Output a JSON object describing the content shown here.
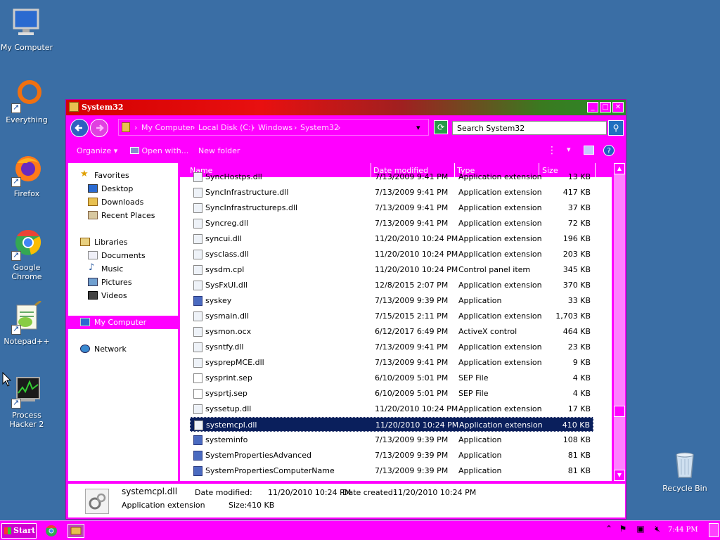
{
  "desktop": {
    "icons": [
      {
        "label": "My Computer"
      },
      {
        "label": "Everything"
      },
      {
        "label": "Firefox"
      },
      {
        "label": "Google Chrome"
      },
      {
        "label": "Notepad++"
      },
      {
        "label": "Process Hacker 2"
      },
      {
        "label": "Recycle Bin"
      }
    ]
  },
  "window": {
    "title": "System32",
    "breadcrumb": [
      "My Computer",
      "Local Disk (C:)",
      "Windows",
      "System32"
    ],
    "search_placeholder": "Search System32",
    "toolbar": {
      "organize": "Organize",
      "open_with": "Open with...",
      "new_folder": "New folder"
    },
    "nav": {
      "favorites": "Favorites",
      "desktop": "Desktop",
      "downloads": "Downloads",
      "recent": "Recent Places",
      "libraries": "Libraries",
      "documents": "Documents",
      "music": "Music",
      "pictures": "Pictures",
      "videos": "Videos",
      "my_computer": "My Computer",
      "network": "Network"
    },
    "columns": {
      "name": "Name",
      "date": "Date modified",
      "type": "Type",
      "size": "Size"
    },
    "files": [
      {
        "name": "SyncHostps.dll",
        "date": "7/13/2009 9:41 PM",
        "type": "Application extension",
        "size": "13 KB"
      },
      {
        "name": "SyncInfrastructure.dll",
        "date": "7/13/2009 9:41 PM",
        "type": "Application extension",
        "size": "417 KB"
      },
      {
        "name": "SyncInfrastructureps.dll",
        "date": "7/13/2009 9:41 PM",
        "type": "Application extension",
        "size": "37 KB"
      },
      {
        "name": "Syncreg.dll",
        "date": "7/13/2009 9:41 PM",
        "type": "Application extension",
        "size": "72 KB"
      },
      {
        "name": "syncui.dll",
        "date": "11/20/2010 10:24 PM",
        "type": "Application extension",
        "size": "196 KB"
      },
      {
        "name": "sysclass.dll",
        "date": "11/20/2010 10:24 PM",
        "type": "Application extension",
        "size": "203 KB"
      },
      {
        "name": "sysdm.cpl",
        "date": "11/20/2010 10:24 PM",
        "type": "Control panel item",
        "size": "345 KB"
      },
      {
        "name": "SysFxUI.dll",
        "date": "12/8/2015 2:07 PM",
        "type": "Application extension",
        "size": "370 KB"
      },
      {
        "name": "syskey",
        "date": "7/13/2009 9:39 PM",
        "type": "Application",
        "size": "33 KB"
      },
      {
        "name": "sysmain.dll",
        "date": "7/15/2015 2:11 PM",
        "type": "Application extension",
        "size": "1,703 KB"
      },
      {
        "name": "sysmon.ocx",
        "date": "6/12/2017 6:49 PM",
        "type": "ActiveX control",
        "size": "464 KB"
      },
      {
        "name": "sysntfy.dll",
        "date": "7/13/2009 9:41 PM",
        "type": "Application extension",
        "size": "23 KB"
      },
      {
        "name": "sysprepMCE.dll",
        "date": "7/13/2009 9:41 PM",
        "type": "Application extension",
        "size": "9 KB"
      },
      {
        "name": "sysprint.sep",
        "date": "6/10/2009 5:01 PM",
        "type": "SEP File",
        "size": "4 KB"
      },
      {
        "name": "sysprtj.sep",
        "date": "6/10/2009 5:01 PM",
        "type": "SEP File",
        "size": "4 KB"
      },
      {
        "name": "syssetup.dll",
        "date": "11/20/2010 10:24 PM",
        "type": "Application extension",
        "size": "17 KB"
      },
      {
        "name": "systemcpl.dll",
        "date": "11/20/2010 10:24 PM",
        "type": "Application extension",
        "size": "410 KB"
      },
      {
        "name": "systeminfo",
        "date": "7/13/2009 9:39 PM",
        "type": "Application",
        "size": "108 KB"
      },
      {
        "name": "SystemPropertiesAdvanced",
        "date": "7/13/2009 9:39 PM",
        "type": "Application",
        "size": "81 KB"
      },
      {
        "name": "SystemPropertiesComputerName",
        "date": "7/13/2009 9:39 PM",
        "type": "Application",
        "size": "81 KB"
      }
    ],
    "selected_index": 16,
    "details": {
      "filename": "systemcpl.dll",
      "filetype": "Application extension",
      "date_modified_label": "Date modified:",
      "date_modified": "11/20/2010 10:24 PM",
      "date_created_label": "Date created:",
      "date_created": "11/20/2010 10:24 PM",
      "size_label": "Size:",
      "size": "410 KB"
    }
  },
  "taskbar": {
    "start_label": "Start",
    "clock": "7:44 PM"
  },
  "colors": {
    "desktop": "#3a6ea5",
    "window_chrome": "#ff00ff",
    "selection": "#0a1f5c"
  }
}
